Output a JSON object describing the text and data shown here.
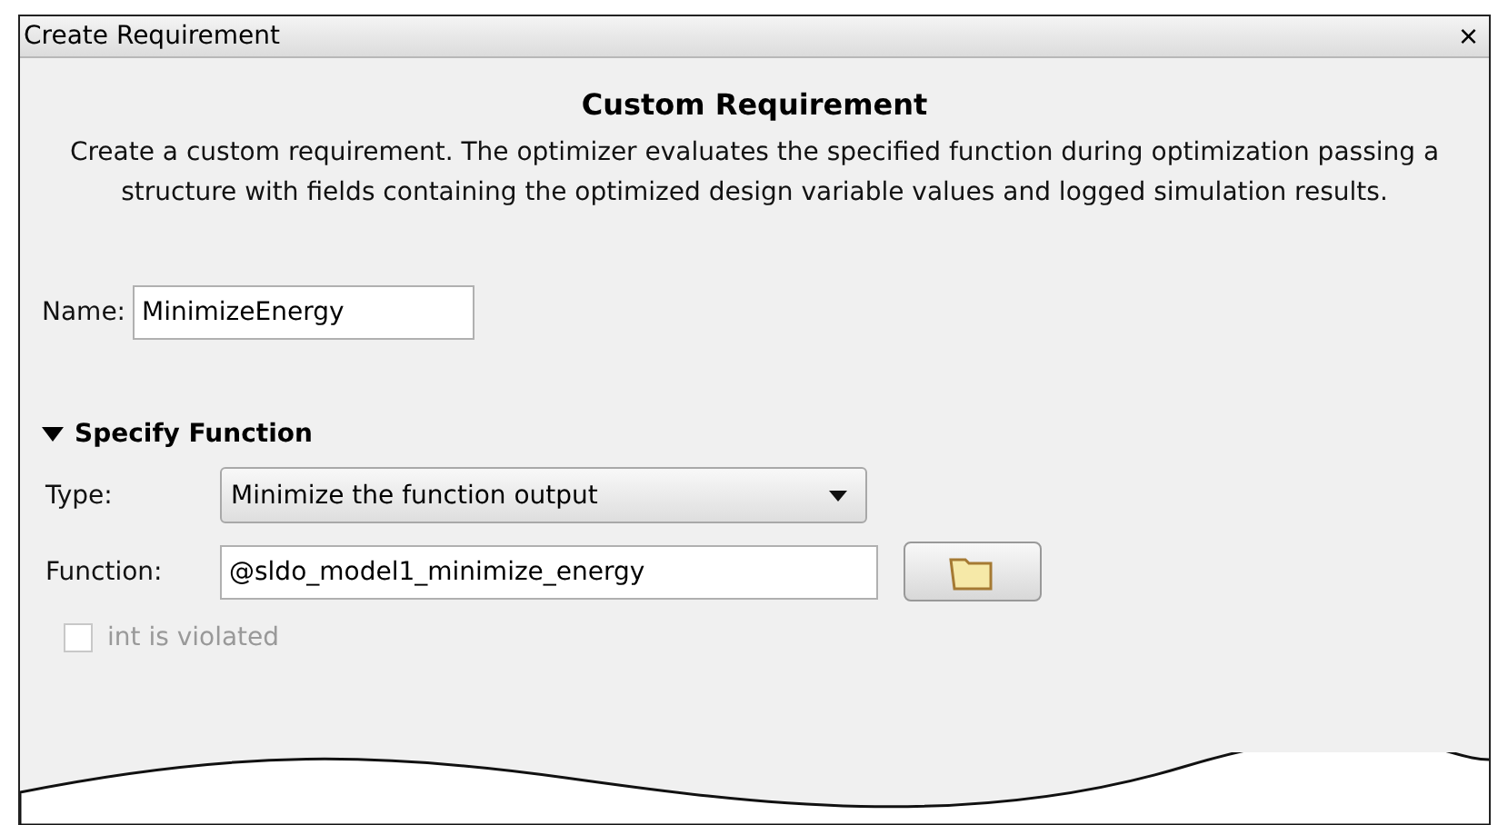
{
  "window": {
    "title": "Create Requirement",
    "close": "×"
  },
  "heading": "Custom Requirement",
  "description": "Create a custom requirement. The optimizer evaluates the specified function during optimization passing a structure with fields containing the optimized design variable values and logged simulation results.",
  "name_field": {
    "label": "Name:",
    "value": "MinimizeEnergy"
  },
  "section": {
    "label": "Specify Function",
    "expanded": true
  },
  "type_field": {
    "label": "Type:",
    "value": "Minimize the function output"
  },
  "function_field": {
    "label": "Function:",
    "value": "@sldo_model1_minimize_energy"
  },
  "checkbox": {
    "label": "int is violated",
    "checked": false,
    "disabled": true
  }
}
